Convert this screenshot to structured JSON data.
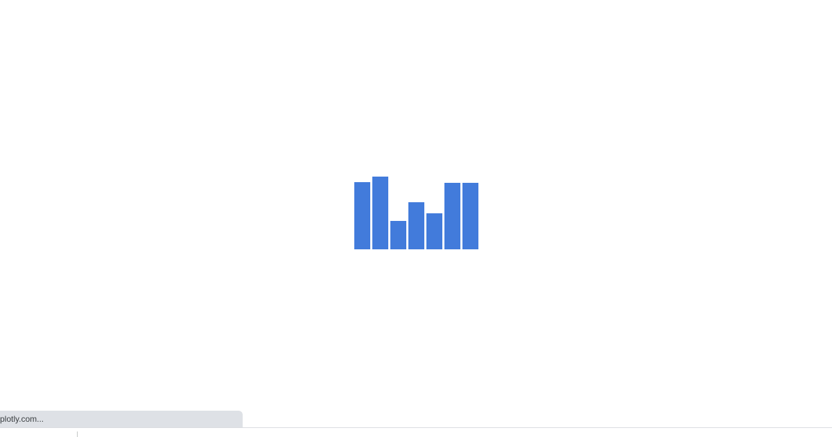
{
  "loader": {
    "icon": "bar-chart-loading-icon",
    "color": "#427bdb",
    "bar_levels": [
      0.885,
      0.955,
      0.375,
      0.615,
      0.47,
      0.875,
      0.875
    ]
  },
  "status_bar": {
    "text": "plotly.com..."
  }
}
